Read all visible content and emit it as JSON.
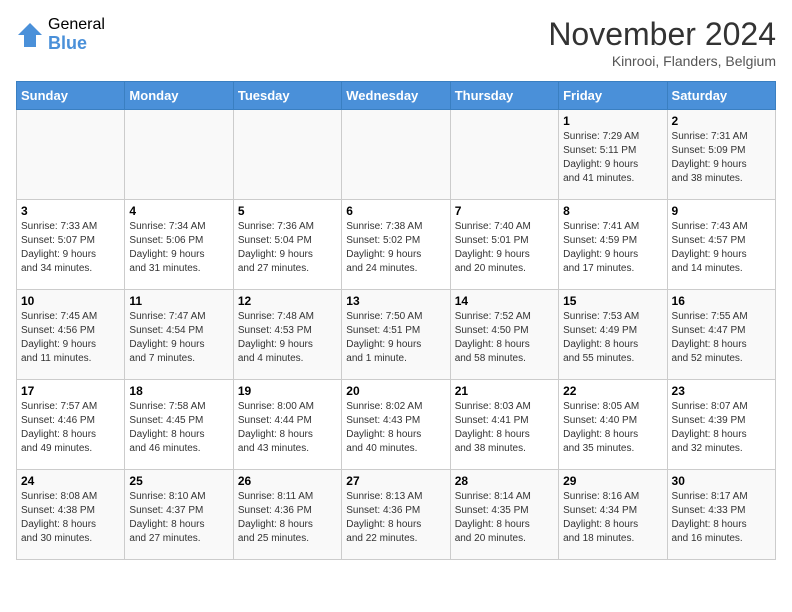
{
  "logo": {
    "general": "General",
    "blue": "Blue"
  },
  "title": "November 2024",
  "subtitle": "Kinrooi, Flanders, Belgium",
  "days_of_week": [
    "Sunday",
    "Monday",
    "Tuesday",
    "Wednesday",
    "Thursday",
    "Friday",
    "Saturday"
  ],
  "weeks": [
    [
      {
        "day": "",
        "info": ""
      },
      {
        "day": "",
        "info": ""
      },
      {
        "day": "",
        "info": ""
      },
      {
        "day": "",
        "info": ""
      },
      {
        "day": "",
        "info": ""
      },
      {
        "day": "1",
        "info": "Sunrise: 7:29 AM\nSunset: 5:11 PM\nDaylight: 9 hours\nand 41 minutes."
      },
      {
        "day": "2",
        "info": "Sunrise: 7:31 AM\nSunset: 5:09 PM\nDaylight: 9 hours\nand 38 minutes."
      }
    ],
    [
      {
        "day": "3",
        "info": "Sunrise: 7:33 AM\nSunset: 5:07 PM\nDaylight: 9 hours\nand 34 minutes."
      },
      {
        "day": "4",
        "info": "Sunrise: 7:34 AM\nSunset: 5:06 PM\nDaylight: 9 hours\nand 31 minutes."
      },
      {
        "day": "5",
        "info": "Sunrise: 7:36 AM\nSunset: 5:04 PM\nDaylight: 9 hours\nand 27 minutes."
      },
      {
        "day": "6",
        "info": "Sunrise: 7:38 AM\nSunset: 5:02 PM\nDaylight: 9 hours\nand 24 minutes."
      },
      {
        "day": "7",
        "info": "Sunrise: 7:40 AM\nSunset: 5:01 PM\nDaylight: 9 hours\nand 20 minutes."
      },
      {
        "day": "8",
        "info": "Sunrise: 7:41 AM\nSunset: 4:59 PM\nDaylight: 9 hours\nand 17 minutes."
      },
      {
        "day": "9",
        "info": "Sunrise: 7:43 AM\nSunset: 4:57 PM\nDaylight: 9 hours\nand 14 minutes."
      }
    ],
    [
      {
        "day": "10",
        "info": "Sunrise: 7:45 AM\nSunset: 4:56 PM\nDaylight: 9 hours\nand 11 minutes."
      },
      {
        "day": "11",
        "info": "Sunrise: 7:47 AM\nSunset: 4:54 PM\nDaylight: 9 hours\nand 7 minutes."
      },
      {
        "day": "12",
        "info": "Sunrise: 7:48 AM\nSunset: 4:53 PM\nDaylight: 9 hours\nand 4 minutes."
      },
      {
        "day": "13",
        "info": "Sunrise: 7:50 AM\nSunset: 4:51 PM\nDaylight: 9 hours\nand 1 minute."
      },
      {
        "day": "14",
        "info": "Sunrise: 7:52 AM\nSunset: 4:50 PM\nDaylight: 8 hours\nand 58 minutes."
      },
      {
        "day": "15",
        "info": "Sunrise: 7:53 AM\nSunset: 4:49 PM\nDaylight: 8 hours\nand 55 minutes."
      },
      {
        "day": "16",
        "info": "Sunrise: 7:55 AM\nSunset: 4:47 PM\nDaylight: 8 hours\nand 52 minutes."
      }
    ],
    [
      {
        "day": "17",
        "info": "Sunrise: 7:57 AM\nSunset: 4:46 PM\nDaylight: 8 hours\nand 49 minutes."
      },
      {
        "day": "18",
        "info": "Sunrise: 7:58 AM\nSunset: 4:45 PM\nDaylight: 8 hours\nand 46 minutes."
      },
      {
        "day": "19",
        "info": "Sunrise: 8:00 AM\nSunset: 4:44 PM\nDaylight: 8 hours\nand 43 minutes."
      },
      {
        "day": "20",
        "info": "Sunrise: 8:02 AM\nSunset: 4:43 PM\nDaylight: 8 hours\nand 40 minutes."
      },
      {
        "day": "21",
        "info": "Sunrise: 8:03 AM\nSunset: 4:41 PM\nDaylight: 8 hours\nand 38 minutes."
      },
      {
        "day": "22",
        "info": "Sunrise: 8:05 AM\nSunset: 4:40 PM\nDaylight: 8 hours\nand 35 minutes."
      },
      {
        "day": "23",
        "info": "Sunrise: 8:07 AM\nSunset: 4:39 PM\nDaylight: 8 hours\nand 32 minutes."
      }
    ],
    [
      {
        "day": "24",
        "info": "Sunrise: 8:08 AM\nSunset: 4:38 PM\nDaylight: 8 hours\nand 30 minutes."
      },
      {
        "day": "25",
        "info": "Sunrise: 8:10 AM\nSunset: 4:37 PM\nDaylight: 8 hours\nand 27 minutes."
      },
      {
        "day": "26",
        "info": "Sunrise: 8:11 AM\nSunset: 4:36 PM\nDaylight: 8 hours\nand 25 minutes."
      },
      {
        "day": "27",
        "info": "Sunrise: 8:13 AM\nSunset: 4:36 PM\nDaylight: 8 hours\nand 22 minutes."
      },
      {
        "day": "28",
        "info": "Sunrise: 8:14 AM\nSunset: 4:35 PM\nDaylight: 8 hours\nand 20 minutes."
      },
      {
        "day": "29",
        "info": "Sunrise: 8:16 AM\nSunset: 4:34 PM\nDaylight: 8 hours\nand 18 minutes."
      },
      {
        "day": "30",
        "info": "Sunrise: 8:17 AM\nSunset: 4:33 PM\nDaylight: 8 hours\nand 16 minutes."
      }
    ]
  ]
}
